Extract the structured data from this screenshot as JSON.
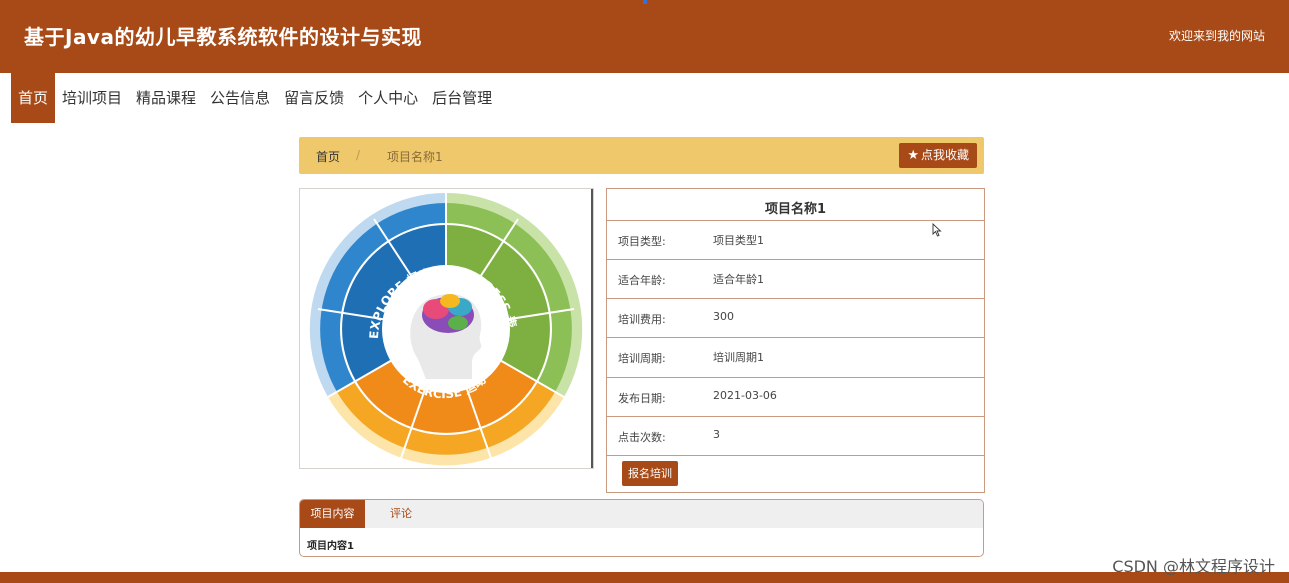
{
  "header": {
    "title": "基于Java的幼儿早教系统软件的设计与实现",
    "welcome": "欢迎来到我的网站"
  },
  "nav": {
    "items": [
      {
        "label": "首页",
        "active": true
      },
      {
        "label": "培训项目"
      },
      {
        "label": "精品课程"
      },
      {
        "label": "公告信息"
      },
      {
        "label": "留言反馈"
      },
      {
        "label": "个人中心"
      },
      {
        "label": "后台管理"
      }
    ]
  },
  "breadcrumb": {
    "home": "首页",
    "separator": "/",
    "current": "项目名称1",
    "favorite_label": "点我收藏"
  },
  "detail": {
    "title": "项目名称1",
    "rows": [
      {
        "label": "项目类型:",
        "value": "项目类型1"
      },
      {
        "label": "适合年龄:",
        "value": "适合年龄1"
      },
      {
        "label": "培训费用:",
        "value": "300"
      },
      {
        "label": "培训周期:",
        "value": "培训周期1"
      },
      {
        "label": "发布日期:",
        "value": "2021-03-06"
      },
      {
        "label": "点击次数:",
        "value": "3"
      }
    ],
    "signup_label": "报名培训"
  },
  "image": {
    "explore": "EXPLORE 探索",
    "express": "EXPRESS 表达",
    "exercise": "EXERCISE 运动"
  },
  "tabs": {
    "items": [
      {
        "label": "项目内容",
        "active": true
      },
      {
        "label": "评论"
      }
    ],
    "content": "项目内容1"
  },
  "watermark": "CSDN @林文程序设计",
  "colors": {
    "brand": "#a84a17",
    "crumb_bg": "#eec86b",
    "blue": "#1f6fb4",
    "green": "#7db040",
    "orange": "#f08a18"
  }
}
